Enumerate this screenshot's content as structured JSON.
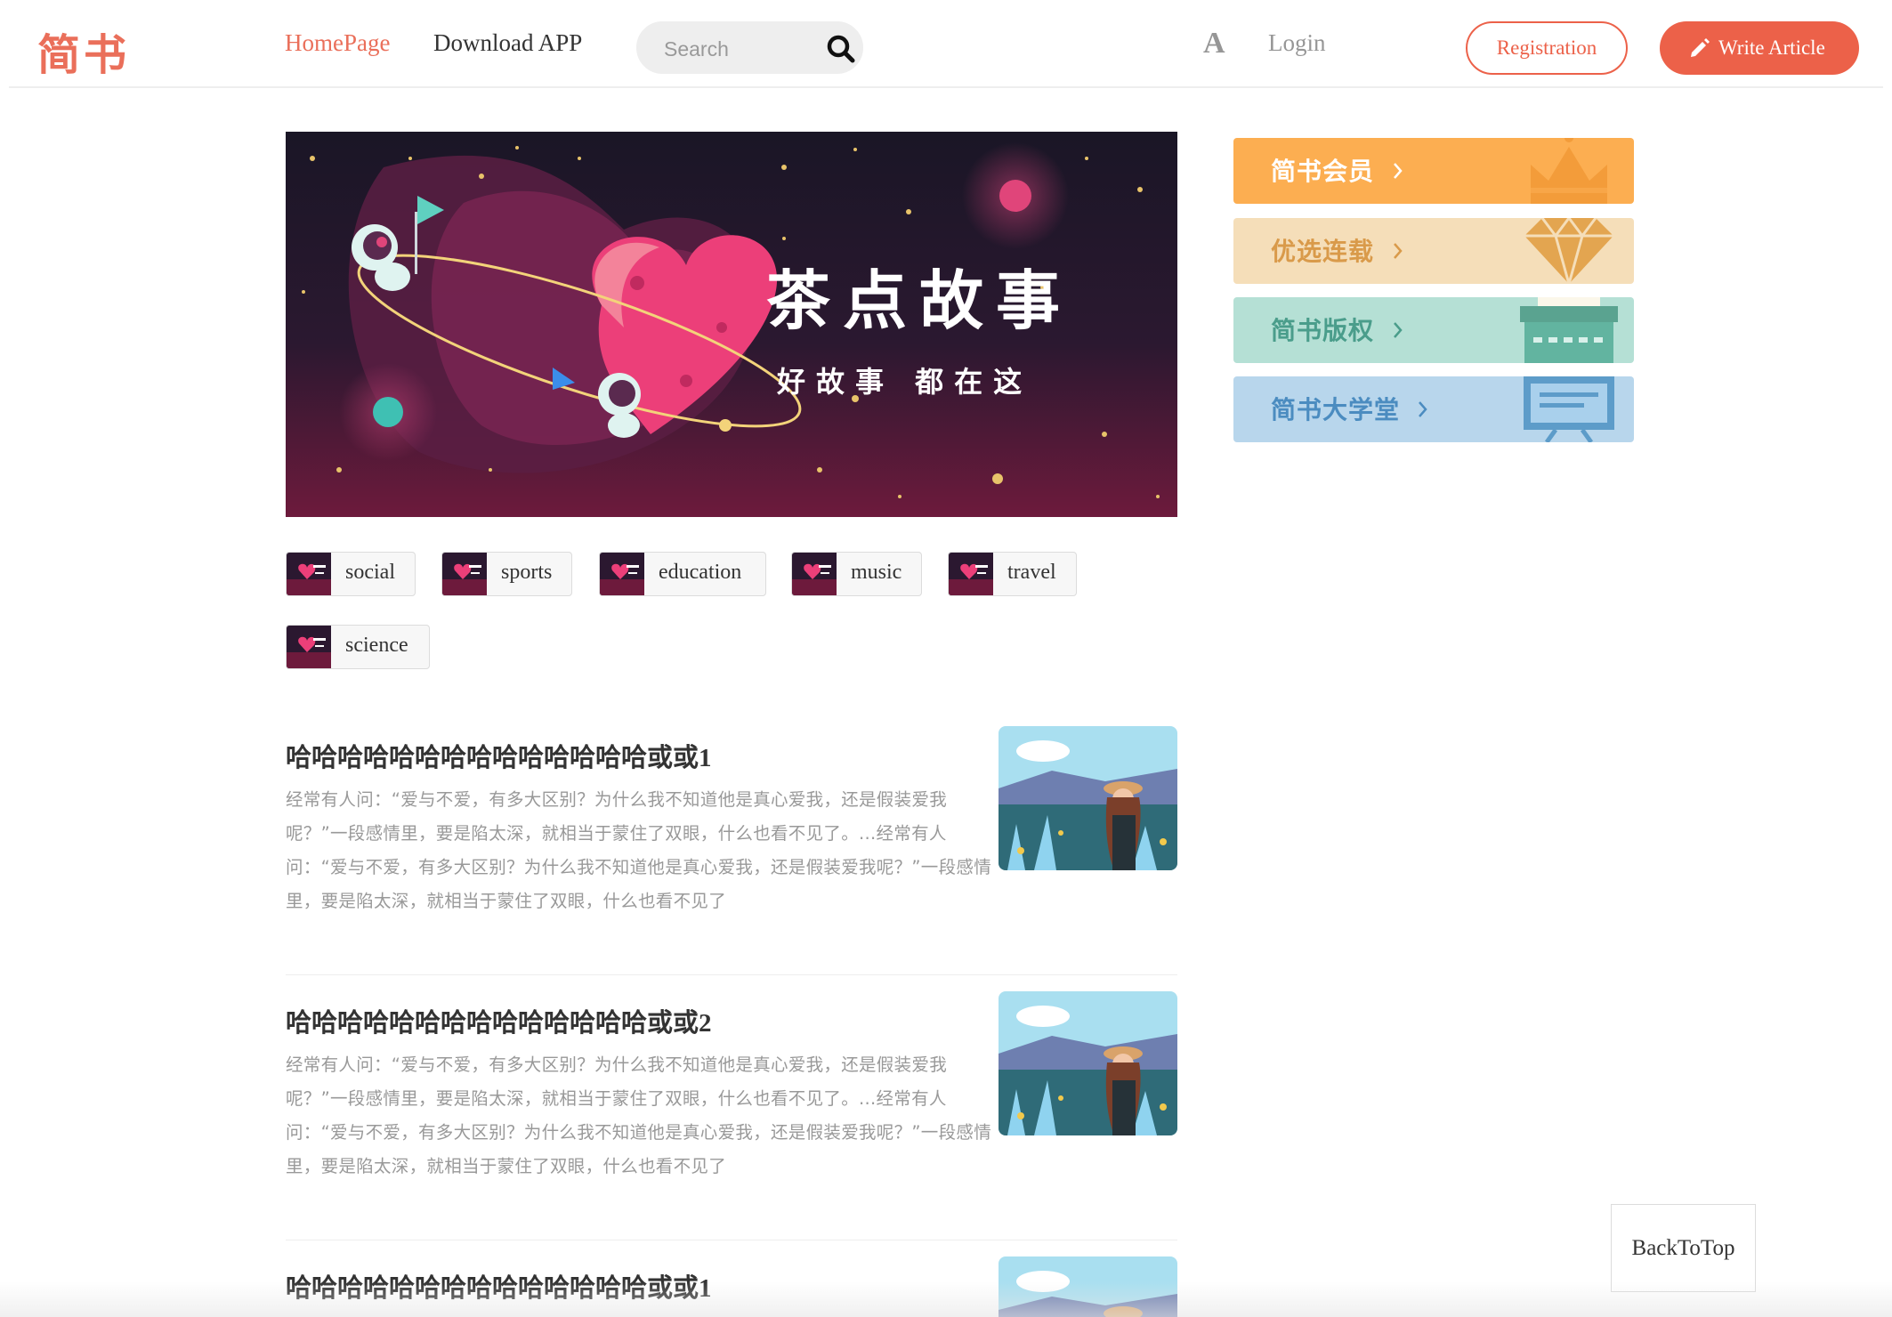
{
  "header": {
    "logo": "简书",
    "nav_home": "HomePage",
    "nav_download": "Download APP",
    "search_placeholder": "Search",
    "font_toggle": "A",
    "login": "Login",
    "register": "Registration",
    "write": "Write Article"
  },
  "banner": {
    "title": "茶点故事",
    "subtitle": "好故事 都在这"
  },
  "topics": [
    {
      "label": "social"
    },
    {
      "label": "sports"
    },
    {
      "label": "education"
    },
    {
      "label": "music"
    },
    {
      "label": "travel"
    },
    {
      "label": "science"
    }
  ],
  "articles": [
    {
      "title": "哈哈哈哈哈哈哈哈哈哈哈哈哈哈或或1",
      "abstract": "经常有人问：“爱与不爱，有多大区别？为什么我不知道他是真心爱我，还是假装爱我呢？”一段感情里，要是陷太深，就相当于蒙住了双眼，什么也看不见了。...经常有人问：“爱与不爱，有多大区别？为什么我不知道他是真心爱我，还是假装爱我呢？”一段感情里，要是陷太深，就相当于蒙住了双眼，什么也看不见了"
    },
    {
      "title": "哈哈哈哈哈哈哈哈哈哈哈哈哈哈或或2",
      "abstract": "经常有人问：“爱与不爱，有多大区别？为什么我不知道他是真心爱我，还是假装爱我呢？”一段感情里，要是陷太深，就相当于蒙住了双眼，什么也看不见了。...经常有人问：“爱与不爱，有多大区别？为什么我不知道他是真心爱我，还是假装爱我呢？”一段感情里，要是陷太深，就相当于蒙住了双眼，什么也看不见了"
    },
    {
      "title": "哈哈哈哈哈哈哈哈哈哈哈哈哈哈或或1",
      "abstract": ""
    }
  ],
  "boards": [
    {
      "label": "简书会员",
      "color": "#fcae51",
      "icon": "crown-icon"
    },
    {
      "label": "优选连载",
      "color": "#f5deb9",
      "icon": "diamond-icon"
    },
    {
      "label": "简书版权",
      "color": "#b5e0d5",
      "icon": "typewriter-icon"
    },
    {
      "label": "简书大学堂",
      "color": "#b8d6ec",
      "icon": "screen-icon"
    }
  ],
  "back_to_top": "BackToTop",
  "colors": {
    "brand": "#ea6f5a",
    "button": "#ec6149",
    "text": "#333333",
    "muted": "#999999"
  }
}
